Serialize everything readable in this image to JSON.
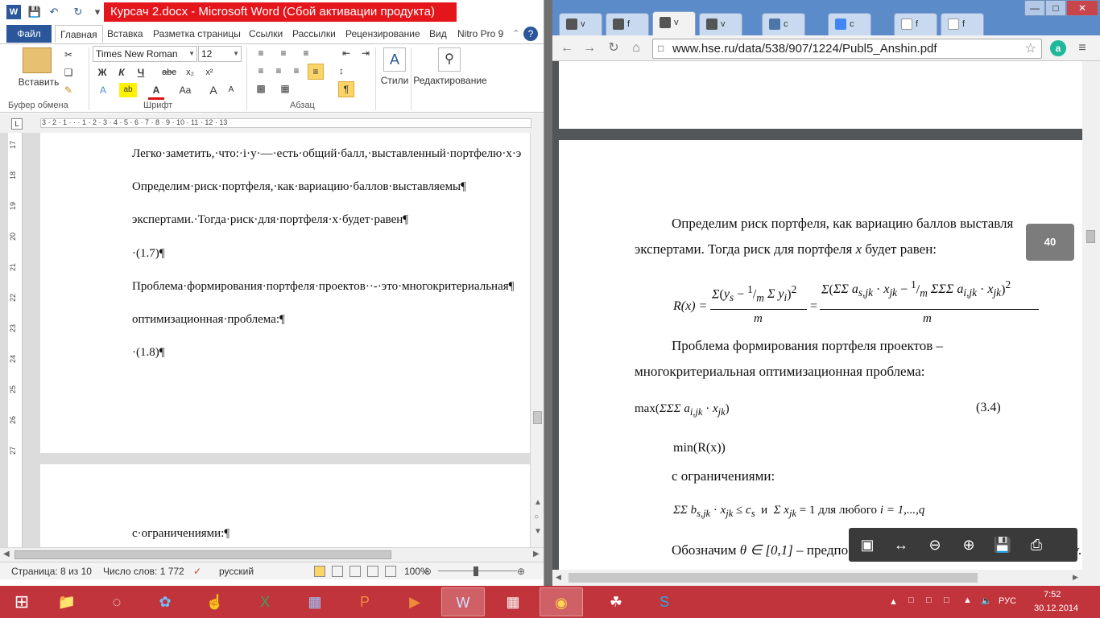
{
  "word": {
    "title": "Курсач 2.docx - Microsoft Word (Сбой активации продукта)",
    "tabs": {
      "file": "Файл",
      "items": [
        "Главная",
        "Вставка",
        "Разметка страницы",
        "Ссылки",
        "Рассылки",
        "Рецензирование",
        "Вид",
        "Nitro Pro 9"
      ]
    },
    "ribbon": {
      "paste_label": "Вставить",
      "group_clipboard": "Буфер обмена",
      "group_font": "Шрифт",
      "group_paragraph": "Абзац",
      "font_name": "Times New Roman",
      "font_size": "12",
      "styles_label": "Стили",
      "editing_label": "Редактирование",
      "bold": "Ж",
      "italic": "К",
      "underline": "Ч",
      "strike": "abc",
      "subscript": "x₂",
      "superscript": "x²",
      "font_color": "A",
      "change_case": "Aa"
    },
    "ruler_numbers": "3 · 2 · 1 · · · 1 · 2 · 3 · 4 · 5 · 6 · 7 · 8 · 9 · 10 · 11 · 12 · 13",
    "vruler_numbers": [
      "17",
      "18",
      "19",
      "20",
      "21",
      "22",
      "23",
      "24",
      "25",
      "26",
      "27"
    ],
    "page1_lines": [
      "Легко·заметить,·что:·i·y·—·есть·общий·балл,·выставленный·портфелю·x·э",
      "Определим·риск·портфеля,·как·вариацию·баллов·выставляемы¶",
      "экспертами.·Тогда·риск·для·портфеля·x·будет·равен¶",
      "·(1.7)¶",
      "Проблема·формирования·портфеля·проектов··-·это·многокритериальная¶",
      "оптимизационная·проблема:¶",
      "·(1.8)¶"
    ],
    "page2_lines": [
      "с·ограничениями:¶"
    ],
    "status": {
      "page": "Страница: 8 из 10",
      "words": "Число слов: 1 772",
      "lang": "русский",
      "zoom": "100%"
    }
  },
  "chrome": {
    "tabs": [
      "v",
      "f",
      "v",
      "v",
      "c",
      "c",
      "f",
      "f"
    ],
    "active_tab": 2,
    "url": "www.hse.ru/data/538/907/1224/Publ5_Anshin.pdf",
    "page_indicator": "40",
    "pdf_lines": {
      "l1": "Определим   риск   портфеля,   как   вариацию   баллов   выставля",
      "l2a": "экспертами. Тогда риск для портфеля ",
      "l2x": "x",
      "l2b": " будет равен:",
      "l3": "Проблема        формирования        портфеля        проектов        –",
      "l4": "многокритериальная оптимизационная проблема:",
      "eqnum": "(3.4)",
      "min": "min(R(x))",
      "constraints_label": "с ограничениями:",
      "constraint_text_a": " для любого ",
      "constraint_text_b": "i = 1,...,q",
      "last_a": "Обозначим  ",
      "last_b": "θ ∈ [0,1]",
      "last_c": "  –  предпо",
      "last_d": "ку.  С"
    },
    "formula_rx": "R(x) =",
    "formula_max": "max",
    "formula_and": "и"
  },
  "taskbar": {
    "lang": "РУС",
    "time": "7:52",
    "date": "30.12.2014"
  }
}
